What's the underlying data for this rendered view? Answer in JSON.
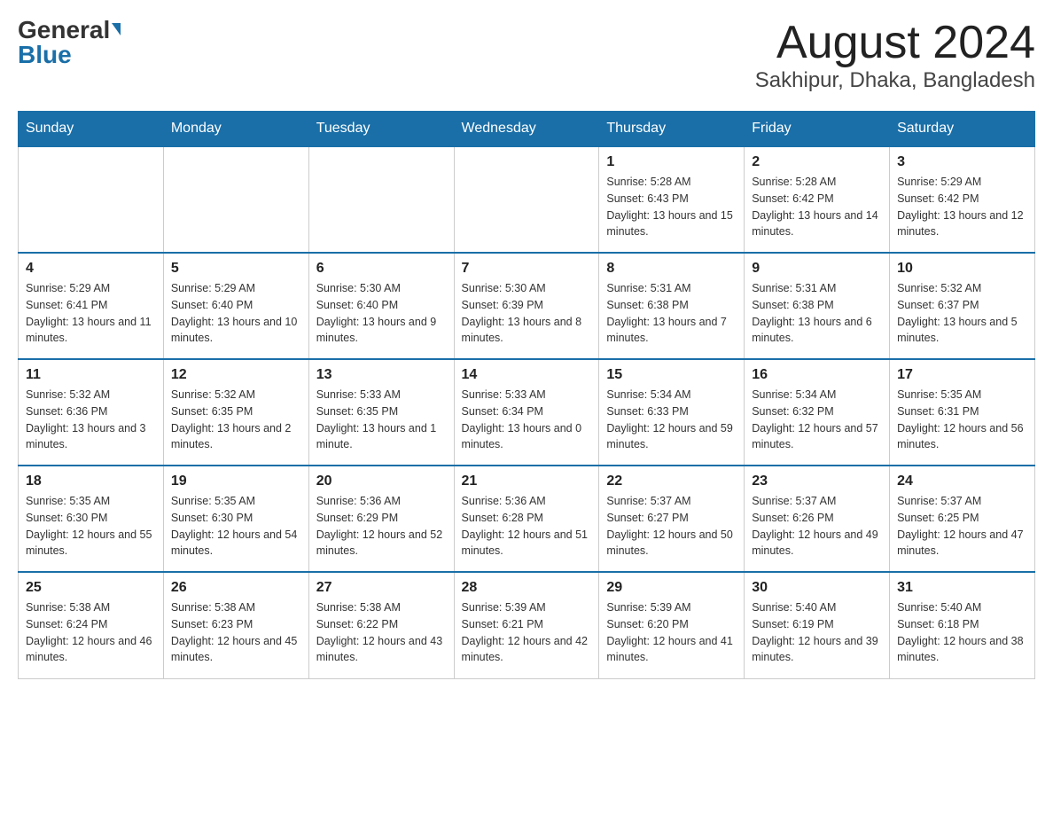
{
  "header": {
    "logo_general": "General",
    "logo_blue": "Blue",
    "title": "August 2024",
    "subtitle": "Sakhipur, Dhaka, Bangladesh"
  },
  "days_of_week": [
    "Sunday",
    "Monday",
    "Tuesday",
    "Wednesday",
    "Thursday",
    "Friday",
    "Saturday"
  ],
  "weeks": [
    [
      {
        "day": "",
        "info": ""
      },
      {
        "day": "",
        "info": ""
      },
      {
        "day": "",
        "info": ""
      },
      {
        "day": "",
        "info": ""
      },
      {
        "day": "1",
        "info": "Sunrise: 5:28 AM\nSunset: 6:43 PM\nDaylight: 13 hours and 15 minutes."
      },
      {
        "day": "2",
        "info": "Sunrise: 5:28 AM\nSunset: 6:42 PM\nDaylight: 13 hours and 14 minutes."
      },
      {
        "day": "3",
        "info": "Sunrise: 5:29 AM\nSunset: 6:42 PM\nDaylight: 13 hours and 12 minutes."
      }
    ],
    [
      {
        "day": "4",
        "info": "Sunrise: 5:29 AM\nSunset: 6:41 PM\nDaylight: 13 hours and 11 minutes."
      },
      {
        "day": "5",
        "info": "Sunrise: 5:29 AM\nSunset: 6:40 PM\nDaylight: 13 hours and 10 minutes."
      },
      {
        "day": "6",
        "info": "Sunrise: 5:30 AM\nSunset: 6:40 PM\nDaylight: 13 hours and 9 minutes."
      },
      {
        "day": "7",
        "info": "Sunrise: 5:30 AM\nSunset: 6:39 PM\nDaylight: 13 hours and 8 minutes."
      },
      {
        "day": "8",
        "info": "Sunrise: 5:31 AM\nSunset: 6:38 PM\nDaylight: 13 hours and 7 minutes."
      },
      {
        "day": "9",
        "info": "Sunrise: 5:31 AM\nSunset: 6:38 PM\nDaylight: 13 hours and 6 minutes."
      },
      {
        "day": "10",
        "info": "Sunrise: 5:32 AM\nSunset: 6:37 PM\nDaylight: 13 hours and 5 minutes."
      }
    ],
    [
      {
        "day": "11",
        "info": "Sunrise: 5:32 AM\nSunset: 6:36 PM\nDaylight: 13 hours and 3 minutes."
      },
      {
        "day": "12",
        "info": "Sunrise: 5:32 AM\nSunset: 6:35 PM\nDaylight: 13 hours and 2 minutes."
      },
      {
        "day": "13",
        "info": "Sunrise: 5:33 AM\nSunset: 6:35 PM\nDaylight: 13 hours and 1 minute."
      },
      {
        "day": "14",
        "info": "Sunrise: 5:33 AM\nSunset: 6:34 PM\nDaylight: 13 hours and 0 minutes."
      },
      {
        "day": "15",
        "info": "Sunrise: 5:34 AM\nSunset: 6:33 PM\nDaylight: 12 hours and 59 minutes."
      },
      {
        "day": "16",
        "info": "Sunrise: 5:34 AM\nSunset: 6:32 PM\nDaylight: 12 hours and 57 minutes."
      },
      {
        "day": "17",
        "info": "Sunrise: 5:35 AM\nSunset: 6:31 PM\nDaylight: 12 hours and 56 minutes."
      }
    ],
    [
      {
        "day": "18",
        "info": "Sunrise: 5:35 AM\nSunset: 6:30 PM\nDaylight: 12 hours and 55 minutes."
      },
      {
        "day": "19",
        "info": "Sunrise: 5:35 AM\nSunset: 6:30 PM\nDaylight: 12 hours and 54 minutes."
      },
      {
        "day": "20",
        "info": "Sunrise: 5:36 AM\nSunset: 6:29 PM\nDaylight: 12 hours and 52 minutes."
      },
      {
        "day": "21",
        "info": "Sunrise: 5:36 AM\nSunset: 6:28 PM\nDaylight: 12 hours and 51 minutes."
      },
      {
        "day": "22",
        "info": "Sunrise: 5:37 AM\nSunset: 6:27 PM\nDaylight: 12 hours and 50 minutes."
      },
      {
        "day": "23",
        "info": "Sunrise: 5:37 AM\nSunset: 6:26 PM\nDaylight: 12 hours and 49 minutes."
      },
      {
        "day": "24",
        "info": "Sunrise: 5:37 AM\nSunset: 6:25 PM\nDaylight: 12 hours and 47 minutes."
      }
    ],
    [
      {
        "day": "25",
        "info": "Sunrise: 5:38 AM\nSunset: 6:24 PM\nDaylight: 12 hours and 46 minutes."
      },
      {
        "day": "26",
        "info": "Sunrise: 5:38 AM\nSunset: 6:23 PM\nDaylight: 12 hours and 45 minutes."
      },
      {
        "day": "27",
        "info": "Sunrise: 5:38 AM\nSunset: 6:22 PM\nDaylight: 12 hours and 43 minutes."
      },
      {
        "day": "28",
        "info": "Sunrise: 5:39 AM\nSunset: 6:21 PM\nDaylight: 12 hours and 42 minutes."
      },
      {
        "day": "29",
        "info": "Sunrise: 5:39 AM\nSunset: 6:20 PM\nDaylight: 12 hours and 41 minutes."
      },
      {
        "day": "30",
        "info": "Sunrise: 5:40 AM\nSunset: 6:19 PM\nDaylight: 12 hours and 39 minutes."
      },
      {
        "day": "31",
        "info": "Sunrise: 5:40 AM\nSunset: 6:18 PM\nDaylight: 12 hours and 38 minutes."
      }
    ]
  ]
}
